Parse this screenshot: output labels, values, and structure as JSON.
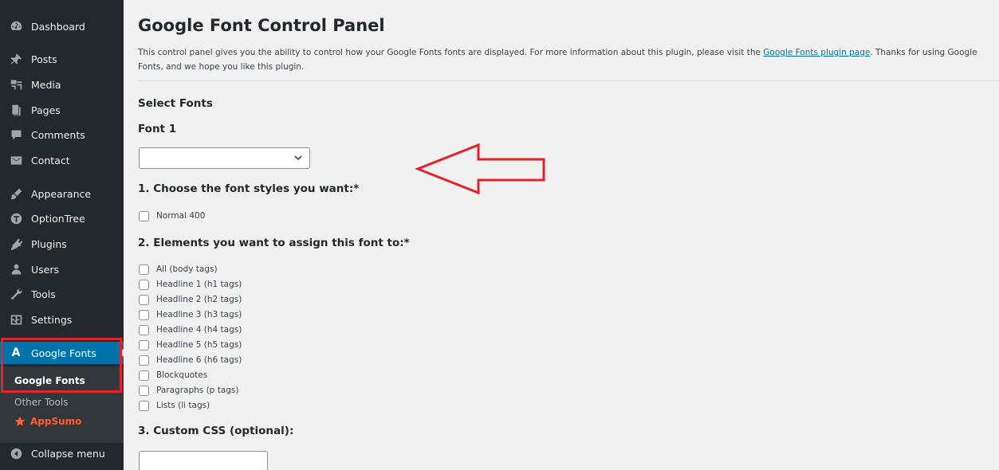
{
  "sidebar": {
    "items": [
      {
        "label": "Dashboard",
        "icon": "dashboard-icon"
      },
      {
        "label": "Posts",
        "icon": "pin-icon"
      },
      {
        "label": "Media",
        "icon": "media-icon"
      },
      {
        "label": "Pages",
        "icon": "pages-icon"
      },
      {
        "label": "Comments",
        "icon": "comment-icon"
      },
      {
        "label": "Contact",
        "icon": "mail-icon"
      },
      {
        "label": "Appearance",
        "icon": "brush-icon"
      },
      {
        "label": "OptionTree",
        "icon": "optiontree-icon"
      },
      {
        "label": "Plugins",
        "icon": "plugin-icon"
      },
      {
        "label": "Users",
        "icon": "users-icon"
      },
      {
        "label": "Tools",
        "icon": "wrench-icon"
      },
      {
        "label": "Settings",
        "icon": "settings-icon"
      }
    ],
    "active": {
      "label": "Google Fonts",
      "icon_glyph": "A"
    },
    "submenu": [
      {
        "label": "Google Fonts"
      },
      {
        "label": "Other Tools"
      },
      {
        "label": "AppSumo"
      }
    ],
    "collapse": {
      "label": "Collapse menu"
    }
  },
  "main": {
    "title": "Google Font Control Panel",
    "intro_prefix": "This control panel gives you the ability to control how your Google Fonts fonts are displayed. For more information about this plugin, please visit the ",
    "intro_link": "Google Fonts plugin page",
    "intro_suffix": ". Thanks for using Google Fonts, and we hope you like this plugin.",
    "select_fonts": "Select Fonts",
    "font1": "Font 1",
    "font_select_value": "",
    "step1": "1. Choose the font styles you want:*",
    "styles": [
      "Normal 400"
    ],
    "step2": "2. Elements you want to assign this font to:*",
    "elements": [
      "All (body tags)",
      "Headline 1 (h1 tags)",
      "Headline 2 (h2 tags)",
      "Headline 3 (h3 tags)",
      "Headline 4 (h4 tags)",
      "Headline 5 (h5 tags)",
      "Headline 6 (h6 tags)",
      "Blockquotes",
      "Paragraphs (p tags)",
      "Lists (li tags)"
    ],
    "step3": "3. Custom CSS (optional):"
  },
  "colors": {
    "sidebar_bg": "#23282d",
    "active_bg": "#0073aa",
    "highlight": "#e2222c",
    "appsumo": "#ff5f2f"
  }
}
